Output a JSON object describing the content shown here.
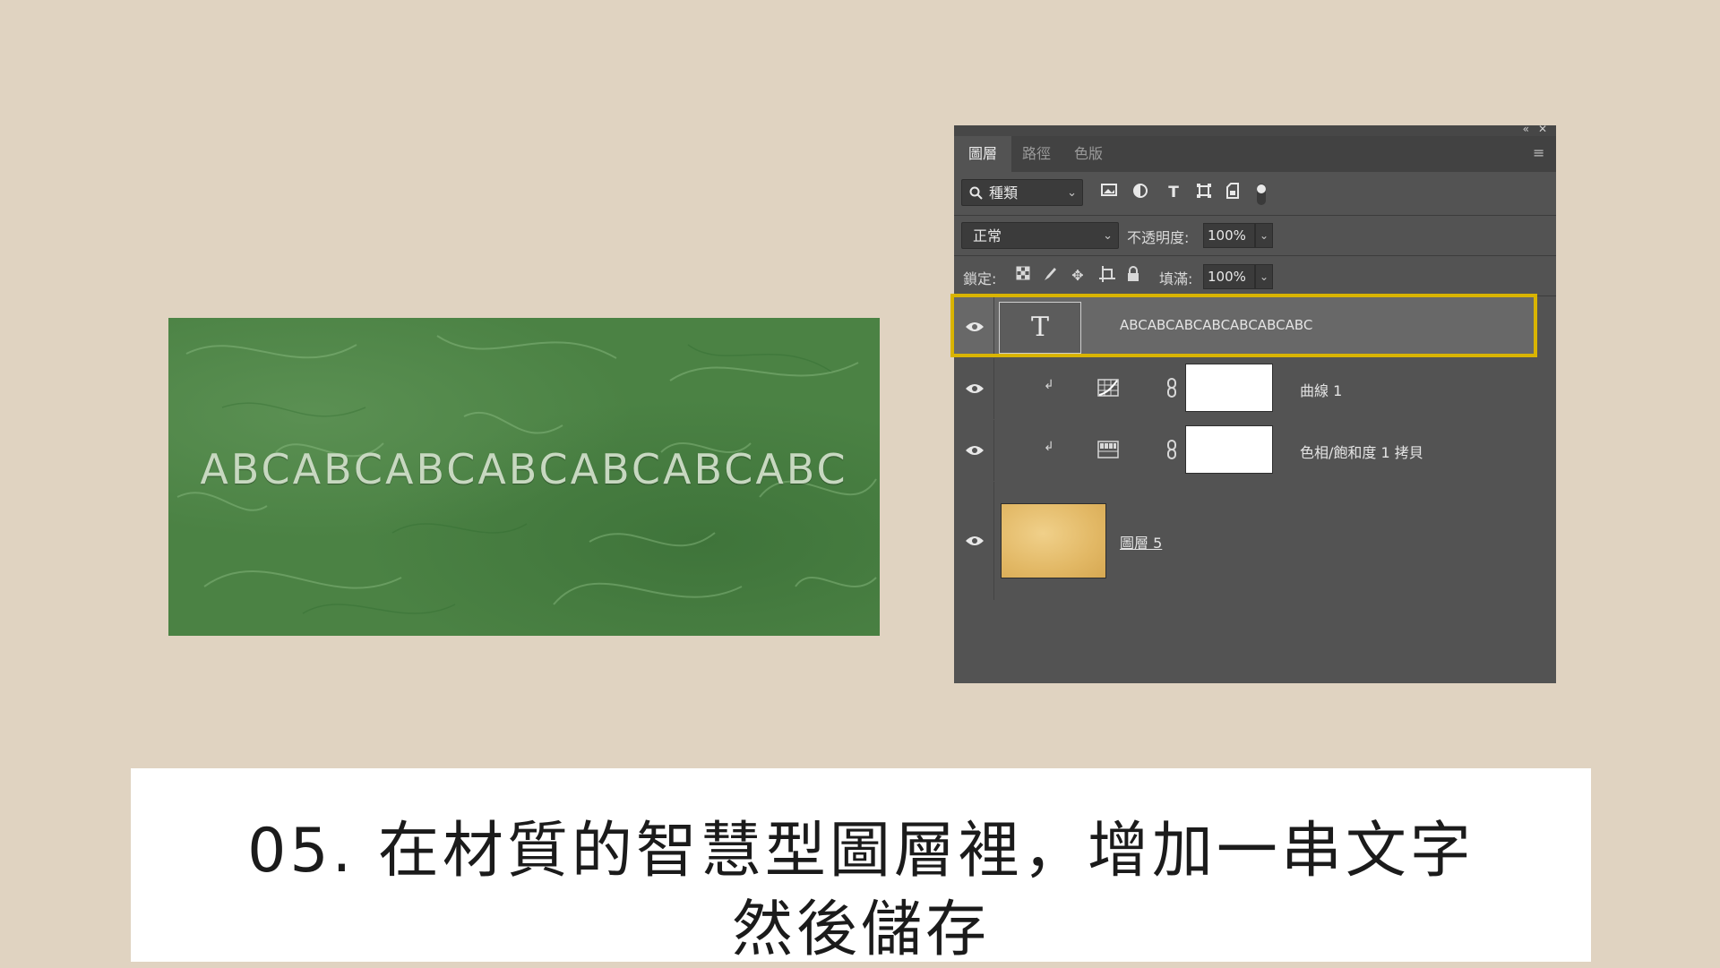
{
  "preview": {
    "text": "ABCABCABCABCABCABCABC",
    "background_color": "#4b8244"
  },
  "panel": {
    "tabs": [
      {
        "label": "圖層",
        "active": true
      },
      {
        "label": "路徑",
        "active": false
      },
      {
        "label": "色版",
        "active": false
      }
    ],
    "filter": {
      "kind_label": "種類",
      "icons": [
        "image-filter-icon",
        "adjustment-filter-icon",
        "type-filter-icon",
        "shape-filter-icon",
        "smart-object-filter-icon",
        "filter-toggle-icon"
      ]
    },
    "blend_mode": "正常",
    "opacity_label": "不透明度:",
    "opacity_value": "100%",
    "lock_label": "鎖定:",
    "lock_icons": [
      "lock-transparent-icon",
      "lock-pixels-icon",
      "lock-position-icon",
      "lock-artboard-icon",
      "lock-all-icon"
    ],
    "fill_label": "填滿:",
    "fill_value": "100%",
    "layers": [
      {
        "name": "ABCABCABCABCABCABCABC",
        "type": "text",
        "thumb_glyph": "T",
        "selected": true,
        "visible": true
      },
      {
        "name": "曲線 1",
        "type": "curves",
        "clipped": true,
        "visible": true
      },
      {
        "name": "色相/飽和度 1 拷貝",
        "type": "hue-saturation",
        "clipped": true,
        "visible": true
      },
      {
        "name": "圖層 5",
        "type": "smart-object",
        "visible": true
      }
    ],
    "highlight_color": "#d9b400"
  },
  "caption": {
    "line1": "05. 在材質的智慧型圖層裡，增加一串文字",
    "line2": "然後儲存"
  }
}
